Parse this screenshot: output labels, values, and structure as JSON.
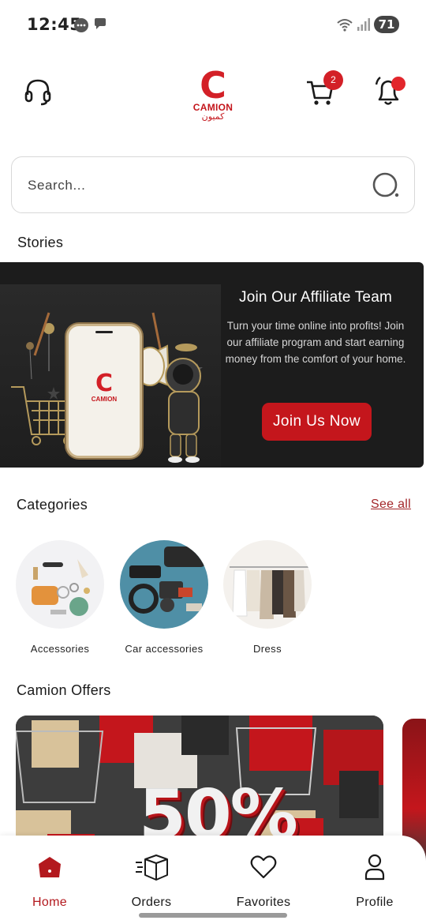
{
  "status_bar": {
    "time": "12:45",
    "battery": "71"
  },
  "header": {
    "logo_letter": "C",
    "logo_name": "CAMION",
    "logo_arabic": "كميون",
    "cart_count": "2"
  },
  "search": {
    "placeholder": "Search..."
  },
  "sections": {
    "stories": "Stories",
    "categories": "Categories",
    "see_all": "See all",
    "offers": "Camion Offers"
  },
  "banner": {
    "title": "Join Our Affiliate Team",
    "text": "Turn your time online into profits! Join our affiliate program and start earning money from the comfort of your home.",
    "button": "Join Us Now",
    "phone_logo_letter": "C",
    "phone_logo_name": "CAMION"
  },
  "categories": [
    {
      "label": "Accessories"
    },
    {
      "label": "Car accessories"
    },
    {
      "label": "Dress"
    }
  ],
  "offer": {
    "headline": "50%"
  },
  "bottom_nav": [
    {
      "label": "Home",
      "icon": "home-icon",
      "active": true
    },
    {
      "label": "Orders",
      "icon": "box-icon",
      "active": false
    },
    {
      "label": "Favorites",
      "icon": "heart-icon",
      "active": false
    },
    {
      "label": "Profile",
      "icon": "person-icon",
      "active": false
    }
  ],
  "colors": {
    "brand": "#c4161c",
    "badge": "#d32027"
  }
}
